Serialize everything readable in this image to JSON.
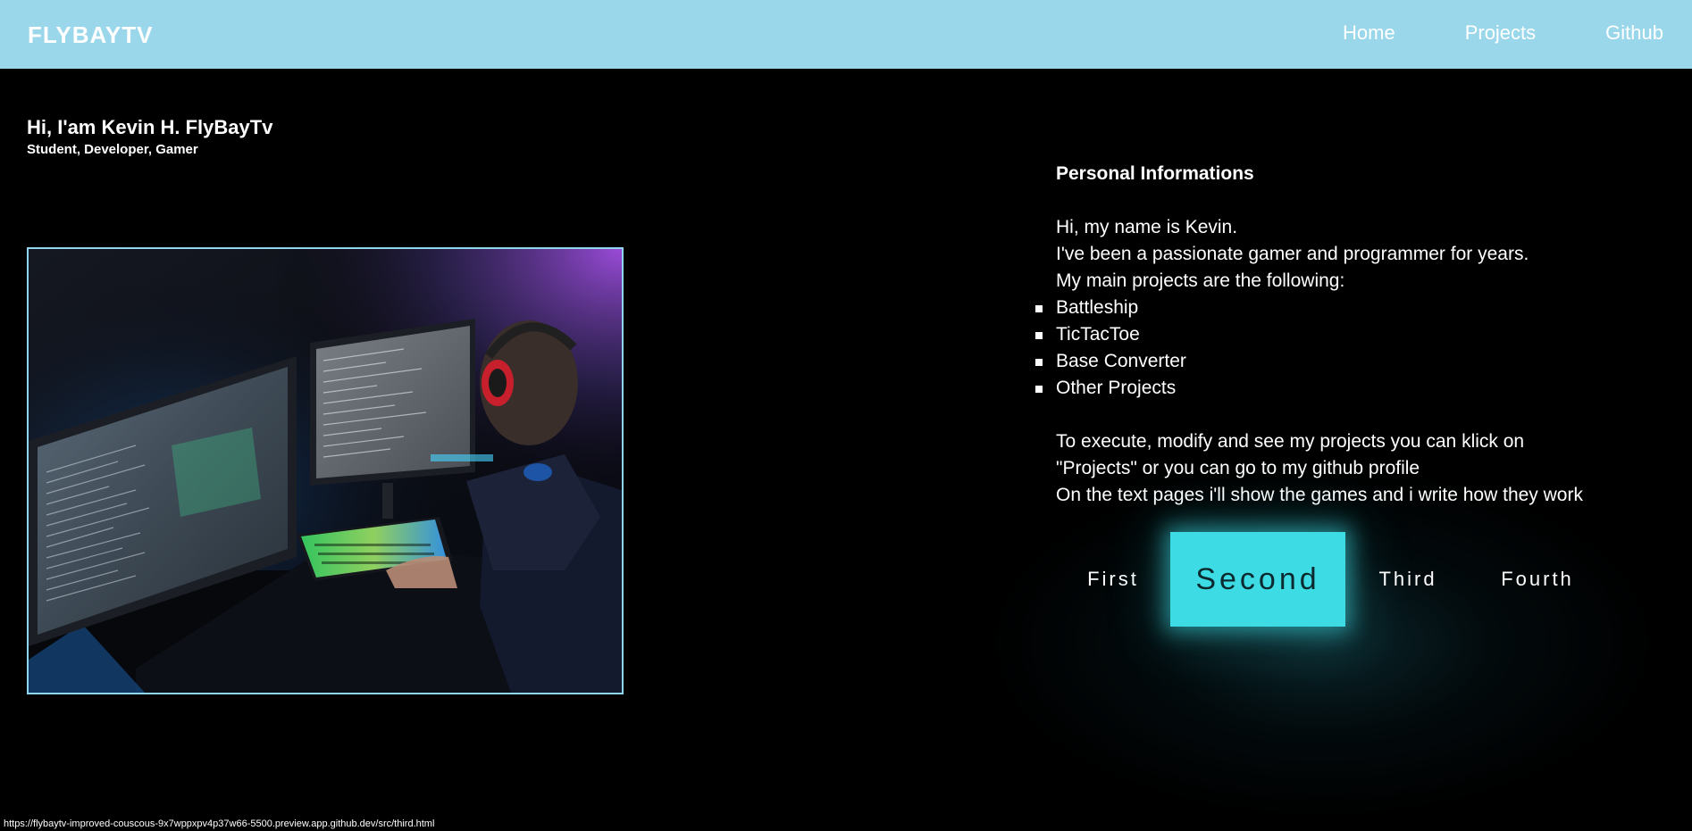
{
  "navbar": {
    "brand": "FLYBAYTV",
    "links": [
      {
        "label": "Home"
      },
      {
        "label": "Projects"
      },
      {
        "label": "Github"
      }
    ]
  },
  "hero": {
    "title": "Hi, I'am Kevin H. FlyBayTv",
    "subtitle": "Student, Developer, Gamer"
  },
  "info": {
    "title": "Personal Informations",
    "intro_lines": [
      "Hi, my name is Kevin.",
      "I've been a passionate gamer and programmer for years.",
      "My main projects are the following:"
    ],
    "projects": [
      "Battleship",
      "TicTacToe",
      "Base Converter",
      "Other Projects"
    ],
    "outro_lines": [
      "To execute, modify and see my projects you can klick on",
      "\"Projects\" or you can go to my github profile",
      "On the text pages i'll show the games and i write how they work"
    ]
  },
  "tabs": [
    {
      "label": "First"
    },
    {
      "label": "Second",
      "active": true
    },
    {
      "label": "Third"
    },
    {
      "label": "Fourth"
    }
  ],
  "status_bar": {
    "url": "https://flybaytv-improved-couscous-9x7wppxpv4p37w66-5500.preview.app.github.dev/src/third.html"
  },
  "colors": {
    "navbar_bg": "#9ad7ea",
    "accent": "#3ddbe4",
    "photo_border": "#8fd6ee",
    "page_bg": "#000000"
  }
}
